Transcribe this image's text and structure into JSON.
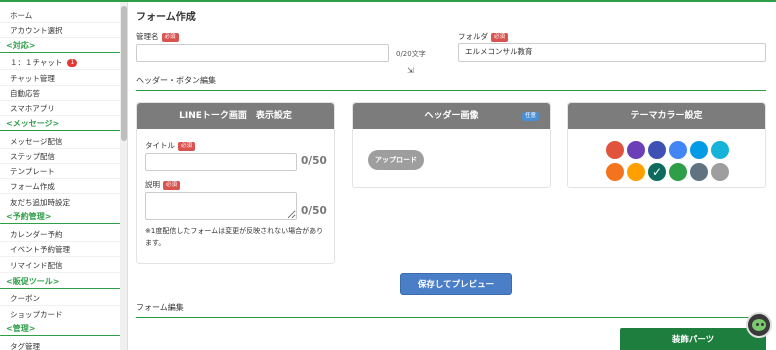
{
  "sidebar": {
    "home": "ホーム",
    "account": "アカウント選択",
    "sec_response": "<対応>",
    "chat": "１：１チャット",
    "chat_badge": "1",
    "chat_manage": "チャット管理",
    "auto_reply": "自動応答",
    "smartphone_app": "スマホアプリ",
    "sec_message": "<メッセージ>",
    "message_delivery": "メッセージ配信",
    "step_delivery": "ステップ配信",
    "template": "テンプレート",
    "form_create": "フォーム作成",
    "friend_add_setting": "友だち追加時設定",
    "sec_reservation": "<予約管理>",
    "calendar": "カレンダー予約",
    "event": "イベント予約管理",
    "remind": "リマインド配信",
    "sec_promo": "<販促ツール>",
    "coupon": "クーポン",
    "shopcard": "ショップカード",
    "sec_manage": "<管理>",
    "tag_manage": "タグ管理"
  },
  "main": {
    "title": "フォーム作成",
    "admin_name_label": "管理名",
    "admin_name_value": "",
    "admin_name_counter": "0/20文字",
    "folder_label": "フォルダ",
    "folder_value": "エルメコンサル教育",
    "required": "必須",
    "header_section": "ヘッダー・ボタン編集",
    "form_edit_section": "フォーム編集"
  },
  "line_card": {
    "title": "LINEトーク画面　表示設定",
    "title_label": "タイトル",
    "title_counter": "0/50",
    "desc_label": "説明",
    "desc_counter": "0/50",
    "note": "※1度配信したフォームは変更が反映されない場合があります。"
  },
  "header_image_card": {
    "title": "ヘッダー画像",
    "optional": "任意",
    "upload": "アップロード"
  },
  "theme_card": {
    "title": "テーマカラー設定",
    "colors_row1": [
      "#e0533d",
      "#6a3fb8",
      "#3f51b5",
      "#4285f4",
      "#039be5",
      "#16b3d8"
    ],
    "colors_row2": [
      "#f4731e",
      "#ffa000",
      "#0d6b5e",
      "#2e9e49",
      "#5f7380",
      "#9e9e9e"
    ],
    "selected": "#0d6b5e"
  },
  "buttons": {
    "save_preview": "保存してプレビュー",
    "decor_parts": "装飾パーツ"
  }
}
